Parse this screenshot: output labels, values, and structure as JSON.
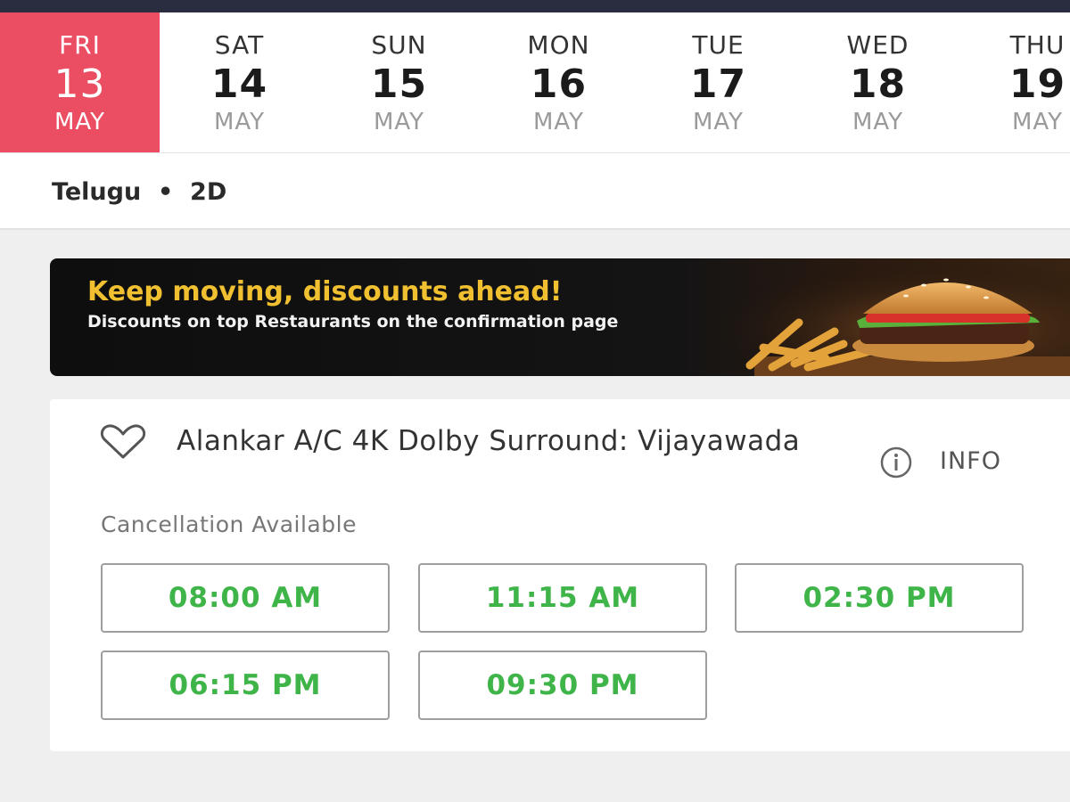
{
  "dates": [
    {
      "dow": "FRI",
      "day": "13",
      "month": "MAY",
      "selected": true
    },
    {
      "dow": "SAT",
      "day": "14",
      "month": "MAY",
      "selected": false
    },
    {
      "dow": "SUN",
      "day": "15",
      "month": "MAY",
      "selected": false
    },
    {
      "dow": "MON",
      "day": "16",
      "month": "MAY",
      "selected": false
    },
    {
      "dow": "TUE",
      "day": "17",
      "month": "MAY",
      "selected": false
    },
    {
      "dow": "WED",
      "day": "18",
      "month": "MAY",
      "selected": false
    },
    {
      "dow": "THU",
      "day": "19",
      "month": "MAY",
      "selected": false
    }
  ],
  "filter": {
    "text": "Telugu  •  2D"
  },
  "banner": {
    "title": "Keep moving, discounts ahead!",
    "subtitle": "Discounts on top Restaurants on the confirmation page",
    "image_icon": "burger-fries-image"
  },
  "cinema": {
    "name": "Alankar A/C 4K Dolby Surround: Vijayawada",
    "favorite_icon": "heart-outline-icon",
    "info_icon": "info-circle-icon",
    "info_label": "INFO",
    "cancellation": "Cancellation Available",
    "showtimes": [
      "08:00 AM",
      "11:15 AM",
      "02:30 PM",
      "06:15 PM",
      "09:30 PM"
    ]
  },
  "colors": {
    "selected_date": "#eb4e62",
    "showtime_available": "#3fb549",
    "banner_title": "#f0c030",
    "top_bar": "#2a2d3f"
  }
}
